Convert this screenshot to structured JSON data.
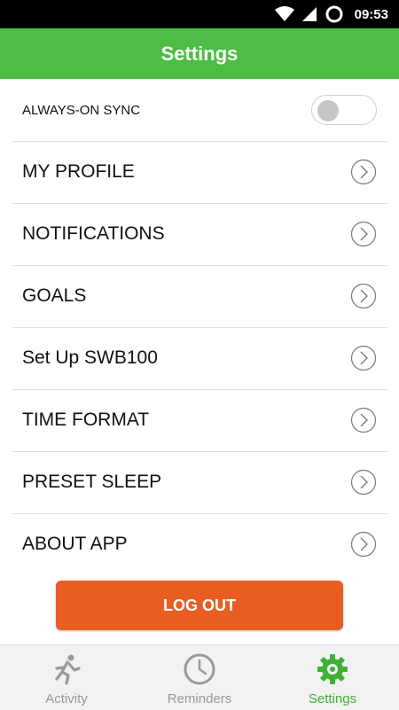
{
  "status_bar": {
    "time": "09:53"
  },
  "header": {
    "title": "Settings"
  },
  "sync": {
    "label": "ALWAYS-ON SYNC",
    "enabled": false
  },
  "menu": [
    {
      "label": "MY PROFILE"
    },
    {
      "label": "NOTIFICATIONS"
    },
    {
      "label": "GOALS"
    },
    {
      "label": "Set Up SWB100"
    },
    {
      "label": "TIME FORMAT"
    },
    {
      "label": "PRESET SLEEP"
    },
    {
      "label": "ABOUT APP"
    }
  ],
  "logout": {
    "label": "LOG OUT"
  },
  "tabs": [
    {
      "label": "Activity",
      "icon": "running-person-icon"
    },
    {
      "label": "Reminders",
      "icon": "clock-icon"
    },
    {
      "label": "Settings",
      "icon": "gear-icon",
      "active": true
    }
  ],
  "colors": {
    "accent": "#4dbd45",
    "button": "#e85e21",
    "active_tab": "#3eb136",
    "inactive_tab": "#9a9a9a"
  }
}
